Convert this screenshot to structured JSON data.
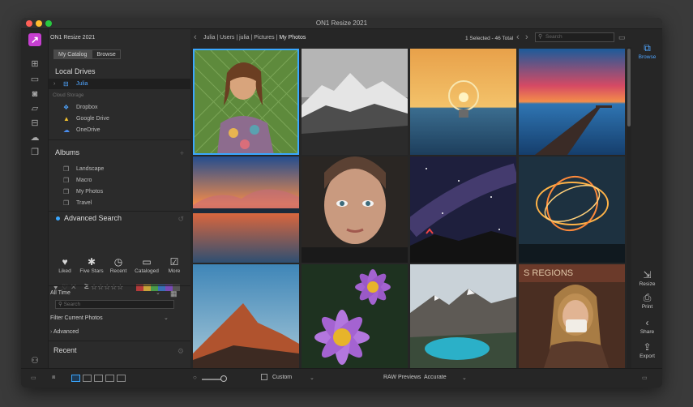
{
  "window": {
    "title": "ON1 Resize 2021"
  },
  "toolstrip": {
    "icons": [
      "plus-icon",
      "monitor-icon",
      "camera-icon",
      "folder-icon",
      "drive-icon",
      "cloud-icon",
      "stack-icon"
    ],
    "bottom_icons": [
      "users-icon",
      "help-icon"
    ]
  },
  "sidebar": {
    "app_name": "ON1 Resize 2021",
    "tabs": [
      "My Catalog",
      "Browse"
    ],
    "active_tab": "My Catalog",
    "local_drives": {
      "title": "Local Drives",
      "items": [
        {
          "label": "Julia",
          "selected": true
        }
      ]
    },
    "cloud_storage": {
      "title": "Cloud Storage",
      "items": [
        "Dropbox",
        "Google Drive",
        "OneDrive"
      ]
    },
    "albums": {
      "title": "Albums",
      "items": [
        "Landscape",
        "Macro",
        "My Photos",
        "Travel"
      ]
    },
    "advanced_search": {
      "title": "Advanced Search",
      "quick_filters": [
        "Liked",
        "Five Stars",
        "Recent",
        "Cataloged",
        "More"
      ],
      "rating_operator": "≥",
      "star_count": 5,
      "color_labels": [
        "#b53a3a",
        "#c9a33a",
        "#4a9a4a",
        "#3a6fb5",
        "#7a4ab5",
        "#555555"
      ],
      "time_filter": "All Time",
      "search_placeholder": "Search",
      "filter_label": "Filter Current Photos",
      "advanced_label": "Advanced"
    },
    "recent": {
      "title": "Recent"
    }
  },
  "topbar": {
    "breadcrumb": [
      "Julia",
      "Users",
      "julia",
      "Pictures"
    ],
    "breadcrumb_last": "My Photos",
    "selection": "1 Selected - 46 Total",
    "search_placeholder": "Search"
  },
  "photos": [
    {
      "subject": "woman-portrait-fence",
      "selected": true
    },
    {
      "subject": "snowy-mountains"
    },
    {
      "subject": "lightbulb-sunset"
    },
    {
      "subject": "pier-sunset"
    },
    {
      "subject": "lake-sunset-clouds"
    },
    {
      "subject": "woman-closeup-face"
    },
    {
      "subject": "starry-night-sky"
    },
    {
      "subject": "light-painting"
    },
    {
      "subject": "red-rock-mountain"
    },
    {
      "subject": "purple-flowers"
    },
    {
      "subject": "mountain-lake"
    },
    {
      "subject": "woman-coffee-cup"
    }
  ],
  "bottombar": {
    "size_label": "Custom",
    "raw_previews_label": "RAW Previews",
    "raw_previews_value": "Accurate"
  },
  "right_modules": [
    {
      "label": "Browse",
      "icon": "browse-icon",
      "active": true
    },
    {
      "label": "Resize",
      "icon": "resize-icon"
    },
    {
      "label": "Print",
      "icon": "print-icon"
    },
    {
      "label": "Share",
      "icon": "share-icon"
    },
    {
      "label": "Export",
      "icon": "export-icon"
    }
  ],
  "colors": {
    "accent": "#4fa5ff",
    "brand": "#c63fd1"
  }
}
